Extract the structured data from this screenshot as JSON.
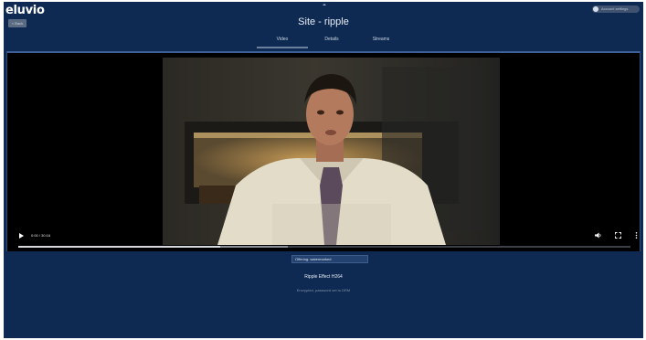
{
  "app": {
    "logo_text": "eluvio",
    "back_label": "< Back",
    "title": "Site - ripple",
    "account_label": "Account settings"
  },
  "tabs": [
    {
      "label": "Video",
      "active": true
    },
    {
      "label": "Details",
      "active": false
    },
    {
      "label": "Streams",
      "active": false
    }
  ],
  "player": {
    "time": "0:00 / 30:16",
    "progress_played": 0.33,
    "progress_buffered": 0.44,
    "icons": [
      "play-icon",
      "volume-icon",
      "fullscreen-icon",
      "more-icon"
    ]
  },
  "offering": {
    "selected": "Offering: watermarked"
  },
  "video": {
    "name": "Ripple Effect H264",
    "published": "Encrypted, password set to DRM"
  },
  "colors": {
    "background": "#0e2a52",
    "player_border": "#3d5f95",
    "title_text": "#e8eef7"
  }
}
